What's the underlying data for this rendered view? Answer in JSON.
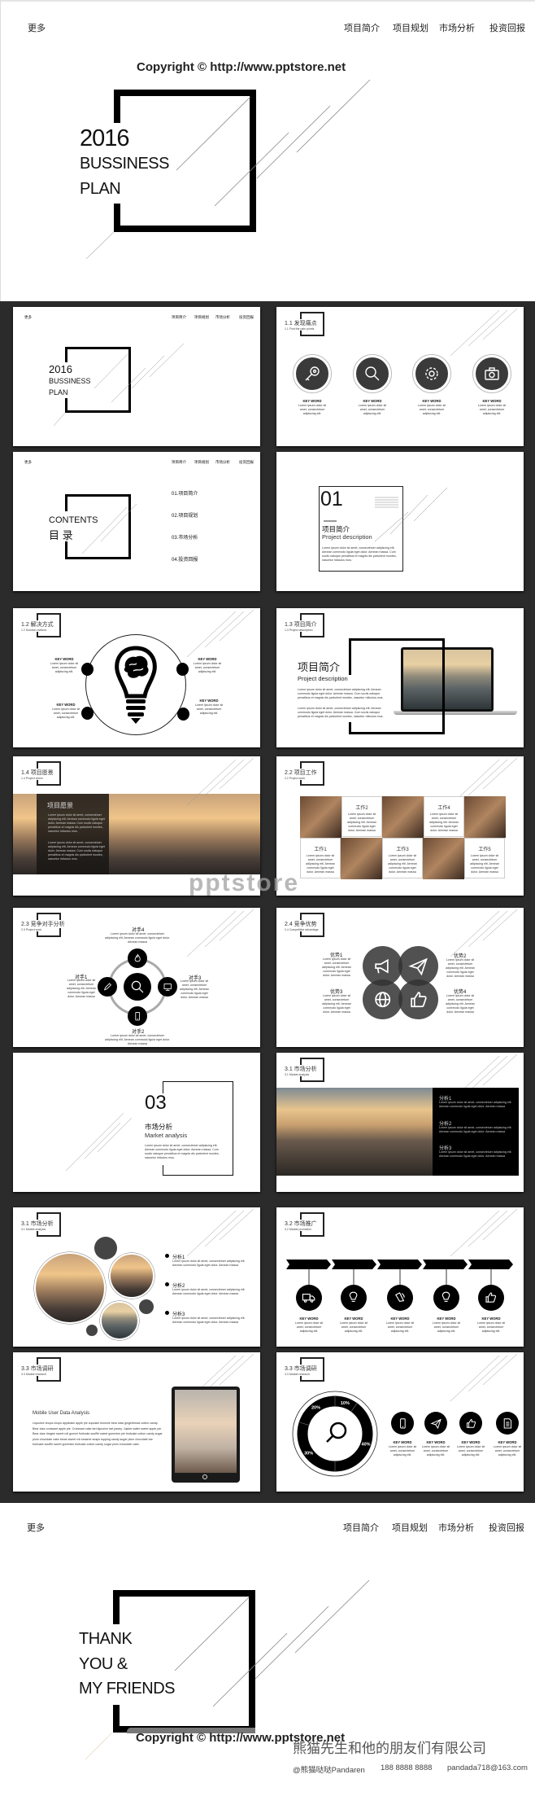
{
  "nav": {
    "more": "更多",
    "items": [
      "项目简介",
      "项目规划",
      "市场分析",
      "投资回报"
    ]
  },
  "copyright": "Copyright © http://www.pptstore.net",
  "watermark": "pptstore",
  "cover": {
    "year": "2016",
    "line1": "BUSSINESS",
    "line2": "PLAN"
  },
  "ending": {
    "line1": "THANK",
    "line2": "YOU &",
    "line3": "MY FRIENDS",
    "company": "熊猫先生和他的朋友们有限公司",
    "weibo": "@熊猫哒哒Pandaren",
    "phone": "188 8888 8888",
    "email": "pandada718@163.com"
  },
  "colors": {
    "background": "#2b2b2b",
    "accent": "#000000",
    "icon_gray": "#444444"
  },
  "slides": {
    "s1": {
      "year": "2016",
      "line1": "BUSSINESS",
      "line2": "PLAN"
    },
    "s2": {
      "title": "1.1 发现痛点",
      "subtitle": "1.1 Find the pain points",
      "items": [
        {
          "icon": "key-icon",
          "label": "KEY WORD",
          "text": "Lorem ipsum dolor sit amet, consectetuer adipiscing elit."
        },
        {
          "icon": "search-icon",
          "label": "KEY WORD",
          "text": "Lorem ipsum dolor sit amet, consectetuer adipiscing elit."
        },
        {
          "icon": "gear-icon",
          "label": "KEY WORD",
          "text": "Lorem ipsum dolor sit amet, consectetuer adipiscing elit."
        },
        {
          "icon": "camera-icon",
          "label": "KEY WORD",
          "text": "Lorem ipsum dolor sit amet, consectetuer adipiscing elit."
        }
      ]
    },
    "s3": {
      "title_en": "CONTENTS",
      "title_cn": "目 录",
      "items": [
        "01.项目简介",
        "02.项目规划",
        "03.市场分析",
        "04.投资回报"
      ]
    },
    "s4": {
      "number": "01",
      "title": "项目简介",
      "subtitle": "Project description",
      "text": "Lorem ipsum dolor sit amet, consectetuer adipiscing elit. Aenean commodo ligula eget dolor. Aenean massa. Cum sociis natoque penatibus et magnis dis parturient montes, nascetur ridiculus mus."
    },
    "s5": {
      "title": "1.2 解决方式",
      "subtitle": "1.2 Solution method",
      "items": [
        {
          "label": "KEY WORD",
          "text": "Lorem ipsum dolor sit amet, consectetuer adipiscing elit."
        },
        {
          "label": "KEY WORD",
          "text": "Lorem ipsum dolor sit amet, consectetuer adipiscing elit."
        },
        {
          "label": "KEY WORD",
          "text": "Lorem ipsum dolor sit amet, consectetuer adipiscing elit."
        },
        {
          "label": "KEY WORD",
          "text": "Lorem ipsum dolor sit amet, consectetuer adipiscing elit."
        }
      ]
    },
    "s6": {
      "title": "1.3 项目简介",
      "subtitle": "1.3 Project description",
      "heading": "项目简介",
      "heading_en": "Project description",
      "p1": "Lorem ipsum dolor sit amet, consectetuer adipiscing elit. Aenean commodo ligula eget dolor. Aenean massa. Cum sociis natoque penatibus et magnis dis parturient montes, nascetur ridiculus mus.",
      "p2": "Lorem ipsum dolor sit amet, consectetuer adipiscing elit. Aenean commodo ligula eget dolor. Aenean massa. Cum sociis natoque penatibus et magnis dis parturient montes, nascetur ridiculus mus."
    },
    "s7": {
      "title": "1.4 项目愿景",
      "subtitle": "1.4 Project vision",
      "heading": "项目愿景",
      "p1": "Lorem ipsum dolor sit amet, consectetuer adipiscing elit. Aenean commodo ligula eget dolor. Aenean massa. Cum sociis natoque penatibus et magnis dis parturient montes, nascetur ridiculus mus.",
      "p2": "Lorem ipsum dolor sit amet, consectetuer adipiscing elit. Aenean commodo ligula eget dolor. Aenean massa. Cum sociis natoque penatibus et magnis dis parturient montes, nascetur ridiculus mus."
    },
    "s8": {
      "title": "2.2 项目工作",
      "subtitle": "2.2 Project work",
      "items": [
        {
          "label": "工作1",
          "text": "Lorem ipsum dolor sit amet, consectetuer adipiscing elit. Aenean commodo ligula eget dolor. Aenean massa"
        },
        {
          "label": "工作2",
          "text": "Lorem ipsum dolor sit amet, consectetuer adipiscing elit. Aenean commodo ligula eget dolor. Aenean massa"
        },
        {
          "label": "工作3",
          "text": "Lorem ipsum dolor sit amet, consectetuer adipiscing elit. Aenean commodo ligula eget dolor. Aenean massa"
        },
        {
          "label": "工作4",
          "text": "Lorem ipsum dolor sit amet, consectetuer adipiscing elit. Aenean commodo ligula eget dolor. Aenean massa"
        },
        {
          "label": "工作5",
          "text": "Lorem ipsum dolor sit amet, consectetuer adipiscing elit. Aenean commodo ligula eget dolor. Aenean massa"
        }
      ]
    },
    "s9": {
      "title": "2.3 竞争对手分析",
      "subtitle": "2.3 Project work",
      "items": [
        {
          "label": "对手1",
          "icon": "pencil-icon",
          "text": "Lorem ipsum dolor sit amet, consectetuer adipiscing elit. Aenean commodo ligula eget dolor. Aenean massa"
        },
        {
          "label": "对手2",
          "icon": "phone-icon",
          "text": "Lorem ipsum dolor sit amet, consectetuer adipiscing elit. Aenean commodo ligula eget dolor. Aenean massa"
        },
        {
          "label": "对手3",
          "icon": "monitor-icon",
          "text": "Lorem ipsum dolor sit amet, consectetuer adipiscing elit. Aenean commodo ligula eget dolor. Aenean massa"
        },
        {
          "label": "对手4",
          "icon": "fire-icon",
          "text": "Lorem ipsum dolor sit amet, consectetuer adipiscing elit. Aenean commodo ligula eget dolor. Aenean massa"
        }
      ]
    },
    "s10": {
      "title": "2.4 竞争优势",
      "subtitle": "2.4 Competitive advantage",
      "items": [
        {
          "label": "优势1",
          "icon": "megaphone-icon",
          "text": "Lorem ipsum dolor sit amet, consectetuer adipiscing elit. Aenean commodo ligula eget dolor. Aenean massa"
        },
        {
          "label": "优势2",
          "icon": "paper-plane-icon",
          "text": "Lorem ipsum dolor sit amet, consectetuer adipiscing elit. Aenean commodo ligula eget dolor. Aenean massa"
        },
        {
          "label": "优势3",
          "icon": "globe-icon",
          "text": "Lorem ipsum dolor sit amet, consectetuer adipiscing elit. Aenean commodo ligula eget dolor. Aenean massa"
        },
        {
          "label": "优势4",
          "icon": "thumbs-up-icon",
          "text": "Lorem ipsum dolor sit amet, consectetuer adipiscing elit. Aenean commodo ligula eget dolor. Aenean massa"
        }
      ]
    },
    "s11": {
      "number": "03",
      "title": "市场分析",
      "subtitle": "Market analysis",
      "text": "Lorem ipsum dolor sit amet, consectetuer adipiscing elit. Aenean commodo ligula eget dolor. Aenean massa. Cum sociis natoque penatibus et magnis dis parturient montes, nascetur ridiculus mus."
    },
    "s12": {
      "title": "3.1 市场分析",
      "subtitle": "3.1 Market analysis",
      "items": [
        {
          "label": "分析1",
          "text": "Lorem ipsum dolor sit amet, consectetuer adipiscing elit. Aenean commodo ligula eget dolor. Aenean massa"
        },
        {
          "label": "分析2",
          "text": "Lorem ipsum dolor sit amet, consectetuer adipiscing elit. Aenean commodo ligula eget dolor. Aenean massa"
        },
        {
          "label": "分析3",
          "text": "Lorem ipsum dolor sit amet, consectetuer adipiscing elit. Aenean commodo ligula eget dolor. Aenean massa"
        }
      ]
    },
    "s13": {
      "title": "3.1 市场分析",
      "subtitle": "3.1 Market analysis",
      "items": [
        {
          "label": "分析1",
          "text": "Lorem ipsum dolor sit amet, consectetuer adipiscing elit. Aenean commodo ligula eget dolor. Aenean massa"
        },
        {
          "label": "分析2",
          "text": "Lorem ipsum dolor sit amet, consectetuer adipiscing elit. Aenean commodo ligula eget dolor. Aenean massa"
        },
        {
          "label": "分析3",
          "text": "Lorem ipsum dolor sit amet, consectetuer adipiscing elit. Aenean commodo ligula eget dolor. Aenean massa"
        }
      ]
    },
    "s14": {
      "title": "3.2 市场推广",
      "subtitle": "3.2 Market promotion",
      "items": [
        {
          "icon": "truck-icon",
          "label": "KEY WORD",
          "text": "Lorem ipsum dolor sit amet, consectetuer adipiscing elit."
        },
        {
          "icon": "lightbulb-icon",
          "label": "KEY WORD",
          "text": "Lorem ipsum dolor sit amet, consectetuer adipiscing elit."
        },
        {
          "icon": "speaker-icon",
          "label": "KEY WORD",
          "text": "Lorem ipsum dolor sit amet, consectetuer adipiscing elit."
        },
        {
          "icon": "lightbulb-icon",
          "label": "KEY WORD",
          "text": "Lorem ipsum dolor sit amet, consectetuer adipiscing elit."
        },
        {
          "icon": "thumbs-up-icon",
          "label": "KEY WORD",
          "text": "Lorem ipsum dolor sit amet, consectetuer adipiscing elit."
        }
      ]
    },
    "s15": {
      "title": "3.3 市场调研",
      "subtitle": "3.3 Market research",
      "heading": "Mobile User Data Analysis",
      "text": "Liquorice chupa chups applicake apple pie cupcake brownie bear claw gingerbread cotton candy. Bear claw croissant apple pie. Croissant cake tart liquorice tart pastry. Jujube wafer sweet apple pie. Bear claw dragée sweet roll gummi fruitcake soufflé sweet gummies pie fruitcake cotton candy sugar plum chocolate cake bears sweet roll sesame snaps topping candy sugar plum chocolate bar fruitcake soufflé sweet gummies fruitcake cotton candy sugar plum chocolate cake."
    },
    "s16": {
      "title": "3.3 市场调研",
      "subtitle": "3.3 Market research",
      "donut": [
        {
          "label": "10%",
          "value": 10
        },
        {
          "label": "40%",
          "value": 40
        },
        {
          "label": "30%",
          "value": 30
        },
        {
          "label": "20%",
          "value": 20
        }
      ],
      "items": [
        {
          "icon": "phone-icon",
          "label": "KEY WORD",
          "text": "Lorem ipsum dolor sit amet, consectetuer adipiscing elit."
        },
        {
          "icon": "paper-plane-icon",
          "label": "KEY WORD",
          "text": "Lorem ipsum dolor sit amet, consectetuer adipiscing elit."
        },
        {
          "icon": "thumbs-up-icon",
          "label": "KEY WORD",
          "text": "Lorem ipsum dolor sit amet, consectetuer adipiscing elit."
        },
        {
          "icon": "document-icon",
          "label": "KEY WORD",
          "text": "Lorem ipsum dolor sit amet, consectetuer adipiscing elit."
        }
      ]
    }
  }
}
